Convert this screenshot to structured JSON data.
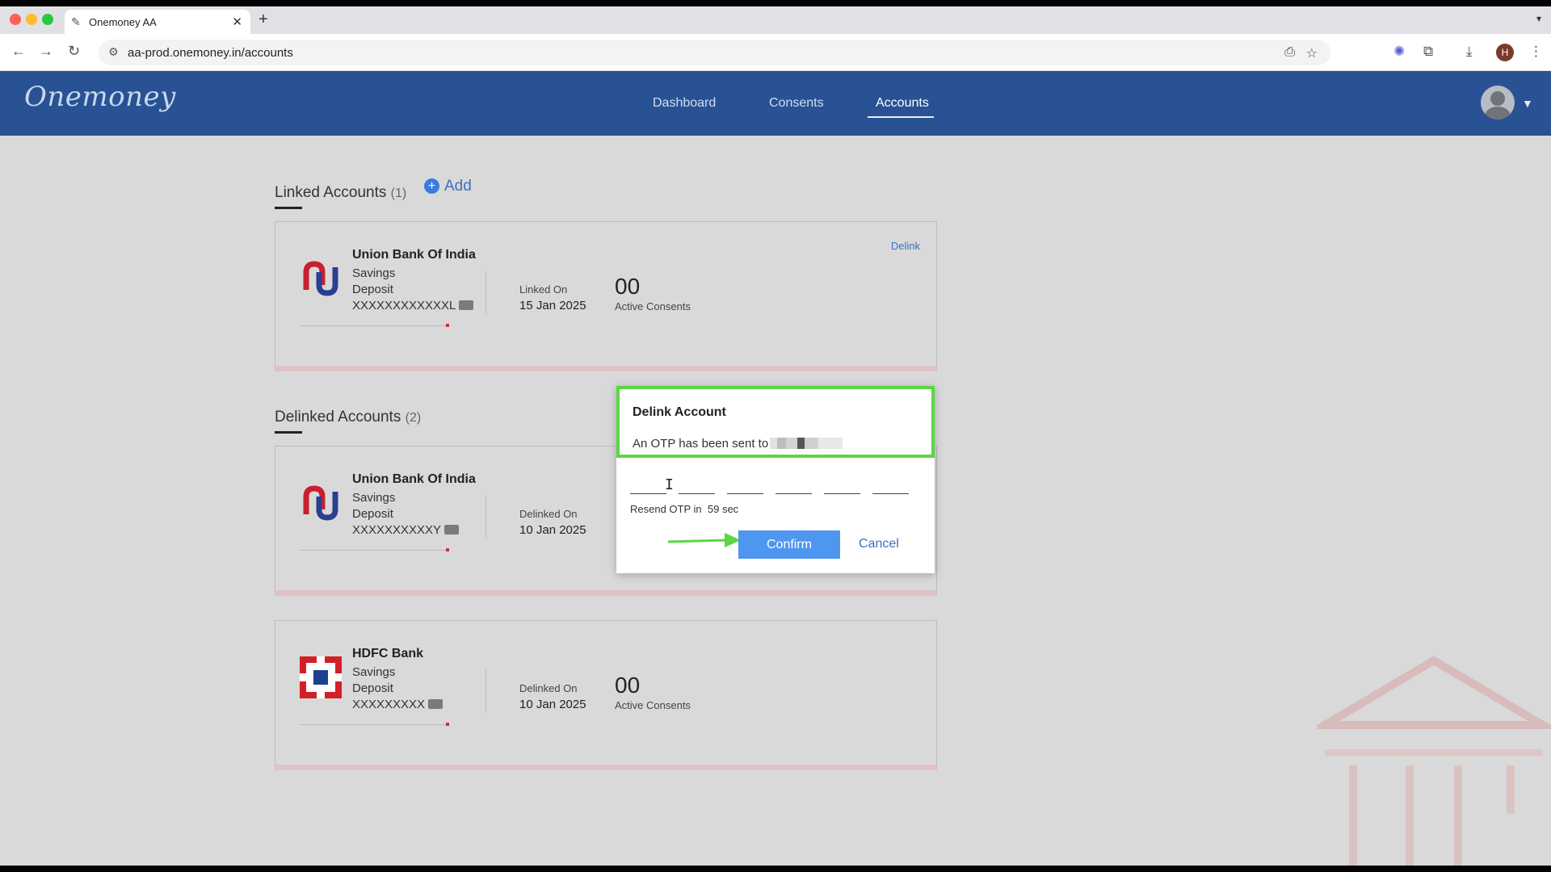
{
  "browser": {
    "tab_title": "Onemoney AA",
    "tab_close": "✕",
    "new_tab": "+",
    "url": "aa-prod.onemoney.in/accounts",
    "profile_initial": "H"
  },
  "app": {
    "logo_text": "Onemoney",
    "nav": [
      "Dashboard",
      "Consents",
      "Accounts"
    ],
    "active_nav": "Accounts"
  },
  "linked_section": {
    "title": "Linked Accounts",
    "count": "(1)",
    "add_label": "Add"
  },
  "linked_accounts": [
    {
      "bank": "Union Bank Of India",
      "type": "Savings",
      "category": "Deposit",
      "masked_number": "XXXXXXXXXXXXL",
      "date_label": "Linked On",
      "date": "15 Jan 2025",
      "consents": "00",
      "consents_label": "Active Consents",
      "action": "Delink"
    }
  ],
  "delinked_section": {
    "title": "Delinked Accounts",
    "count": "(2)"
  },
  "delinked_accounts": [
    {
      "bank": "Union Bank Of India",
      "type": "Savings",
      "category": "Deposit",
      "masked_number": "XXXXXXXXXXY",
      "date_label": "Delinked On",
      "date": "10 Jan 2025"
    },
    {
      "bank": "HDFC Bank",
      "type": "Savings",
      "category": "Deposit",
      "masked_number": "XXXXXXXXX",
      "date_label": "Delinked On",
      "date": "10 Jan 2025",
      "consents": "00",
      "consents_label": "Active Consents"
    }
  ],
  "modal": {
    "title": "Delink Account",
    "message": "An OTP has been sent to",
    "resend_prefix": "Resend OTP in",
    "resend_time": "59 sec",
    "confirm_label": "Confirm",
    "cancel_label": "Cancel"
  },
  "colors": {
    "header_blue": "#285294",
    "confirm_blue": "#4e96f0",
    "highlight_green": "#5bd642",
    "union_bank_red": "#c8202f",
    "union_bank_blue": "#2a3f8f",
    "hdfc_red": "#d32027",
    "hdfc_blue": "#1f3f8f"
  },
  "icons": {
    "back": "arrow-left-icon",
    "forward": "arrow-right-icon",
    "reload": "reload-icon",
    "bookmark": "star-icon",
    "install": "install-icon",
    "extensions": "puzzle-icon",
    "download": "download-icon",
    "menu": "kebab-menu-icon"
  }
}
